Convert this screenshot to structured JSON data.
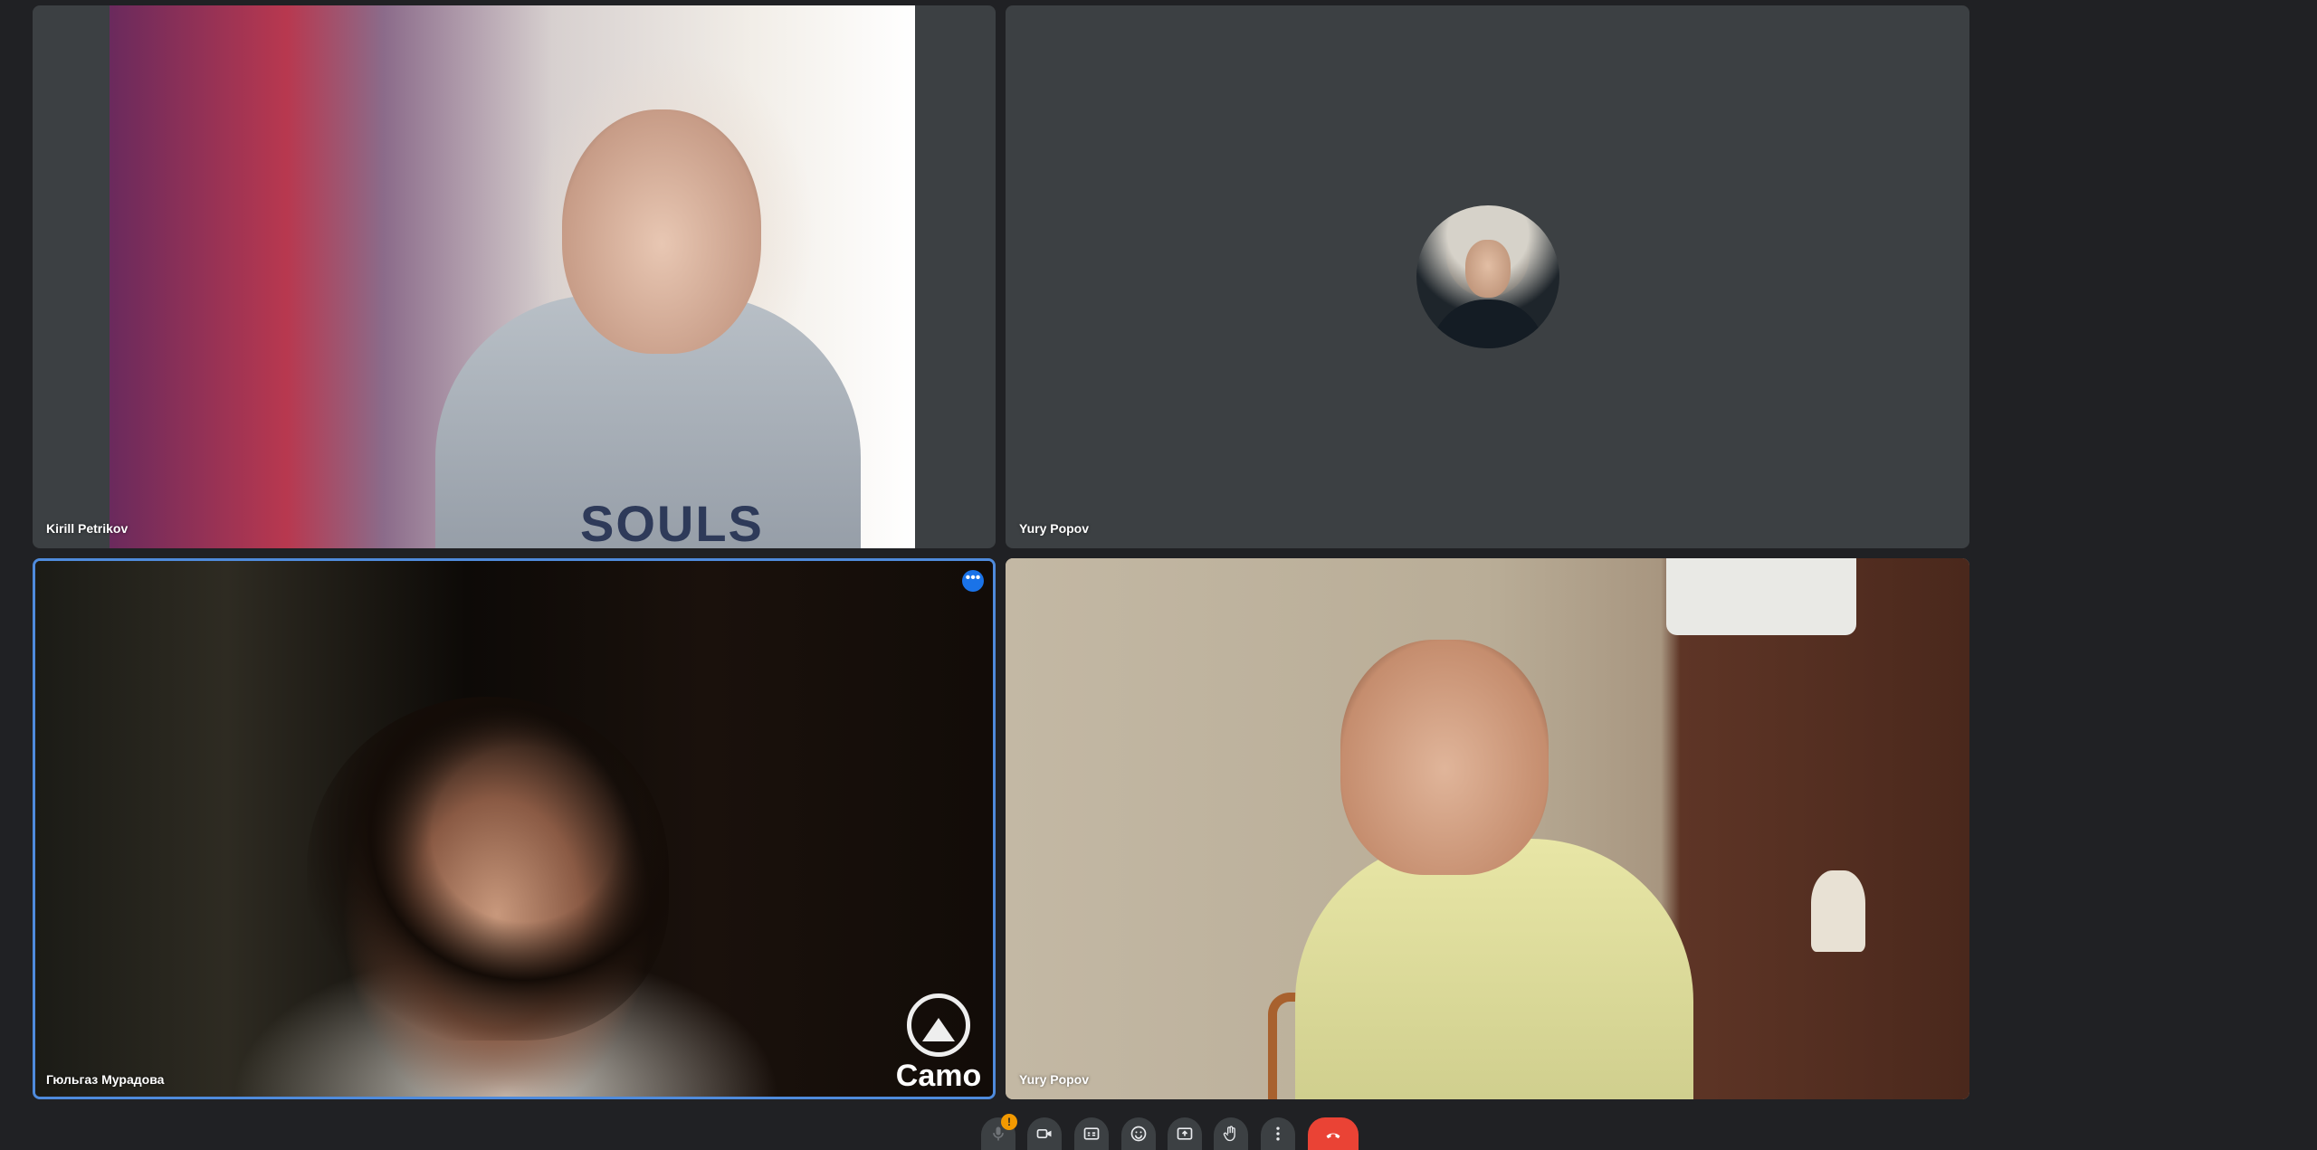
{
  "tiles": [
    {
      "name": "Kirill Petrikov",
      "type": "video",
      "shirt_text": "SOULS"
    },
    {
      "name": "Yury Popov",
      "type": "avatar"
    },
    {
      "name": "Гюльгаз Мурадова",
      "type": "video",
      "active": true,
      "overlay_brand": "Camo"
    },
    {
      "name": "Yury Popov",
      "type": "video"
    }
  ],
  "toolbar": {
    "mic_badge": "!",
    "buttons": [
      "mic-icon",
      "camera-icon",
      "captions-icon",
      "emoji-icon",
      "present-icon",
      "raise-hand-icon",
      "more-options-icon",
      "leave-call-icon"
    ]
  },
  "colors": {
    "background": "#202124",
    "tile": "#3c4043",
    "active_border": "#4f8bdc",
    "end_call": "#ea4335",
    "badge": "#f29900",
    "accent": "#1a73e8"
  }
}
